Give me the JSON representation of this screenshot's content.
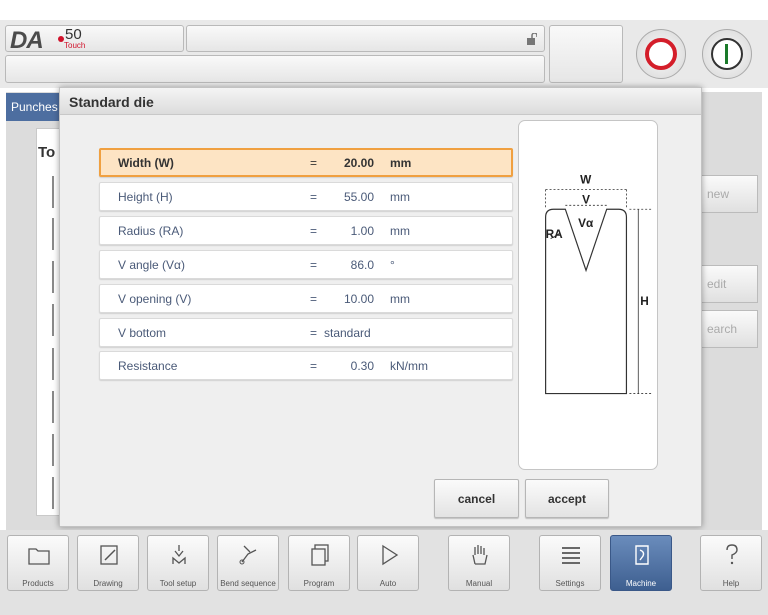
{
  "header": {
    "logo_text": "DA",
    "logo_model": "50",
    "logo_sub": "Touch"
  },
  "background": {
    "tab_label": "Punches",
    "panel_header": "To",
    "right_buttons": {
      "new": "new",
      "edit": "edit",
      "search": "earch"
    }
  },
  "dialog": {
    "title": "Standard die",
    "rows": [
      {
        "label": "Width (W)",
        "eq": "=",
        "value": "20.00",
        "unit": "mm",
        "selected": true
      },
      {
        "label": "Height (H)",
        "eq": "=",
        "value": "55.00",
        "unit": "mm"
      },
      {
        "label": "Radius (RA)",
        "eq": "=",
        "value": "1.00",
        "unit": "mm"
      },
      {
        "label": "V angle (Vα)",
        "eq": "=",
        "value": "86.0",
        "unit": "°"
      },
      {
        "label": "V opening (V)",
        "eq": "=",
        "value": "10.00",
        "unit": "mm"
      },
      {
        "label": "V bottom",
        "eq": "=",
        "value": "standard",
        "unit": ""
      },
      {
        "label": "Resistance",
        "eq": "=",
        "value": "0.30",
        "unit": "kN/mm"
      }
    ],
    "diagram_labels": {
      "w": "W",
      "v": "V",
      "valpha": "Vα",
      "ra": "RA",
      "h": "H"
    },
    "cancel_label": "cancel",
    "accept_label": "accept"
  },
  "nav": [
    {
      "label": "Products",
      "icon": "folder-icon"
    },
    {
      "label": "Drawing",
      "icon": "pencil-icon"
    },
    {
      "label": "Tool setup",
      "icon": "tool-icon"
    },
    {
      "label": "Bend sequence",
      "icon": "bend-icon"
    },
    {
      "label": "Program",
      "icon": "program-icon"
    },
    {
      "label": "Auto",
      "icon": "play-icon"
    },
    {
      "label": "Manual",
      "icon": "hand-icon"
    },
    {
      "label": "Settings",
      "icon": "settings-icon"
    },
    {
      "label": "Machine",
      "icon": "machine-icon",
      "active": true
    },
    {
      "label": "Help",
      "icon": "help-icon"
    }
  ]
}
